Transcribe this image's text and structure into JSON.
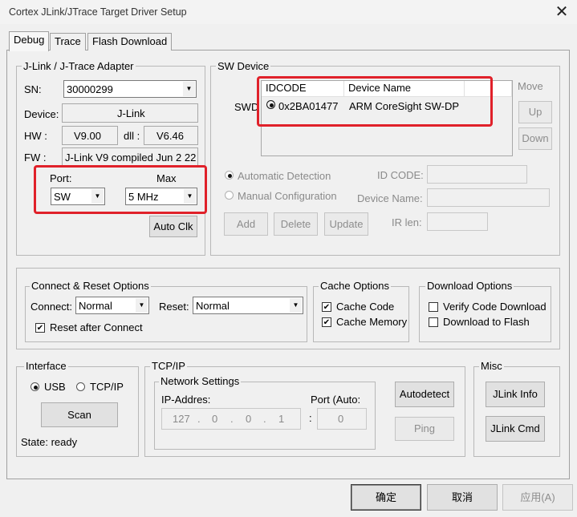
{
  "window": {
    "title": "Cortex JLink/JTrace Target Driver Setup"
  },
  "tabs": [
    "Debug",
    "Trace",
    "Flash Download"
  ],
  "adapter": {
    "group_label": "J-Link / J-Trace Adapter",
    "sn_label": "SN:",
    "sn_value": "30000299",
    "device_label": "Device:",
    "device_value": "J-Link",
    "hw_label": "HW :",
    "hw_value": "V9.00",
    "dll_label": "dll :",
    "dll_value": "V6.46",
    "fw_label": "FW :",
    "fw_value": "J-Link V9 compiled Jun  2 22",
    "port_label": "Port:",
    "port_value": "SW",
    "max_label": "Max",
    "max_value": "5 MHz",
    "auto_clk": "Auto Clk"
  },
  "sw_device": {
    "group_label": "SW Device",
    "swd_label": "SWD",
    "col_idcode": "IDCODE",
    "col_name": "Device Name",
    "row_idcode": "0x2BA01477",
    "row_name": "ARM CoreSight SW-DP",
    "move_label": "Move",
    "up": "Up",
    "down": "Down",
    "auto_detect": "Automatic Detection",
    "manual_config": "Manual Configuration",
    "id_code_label": "ID CODE:",
    "device_name_label": "Device Name:",
    "ir_len_label": "IR len:",
    "add": "Add",
    "delete": "Delete",
    "update": "Update"
  },
  "connect_reset": {
    "group_label": "Connect & Reset Options",
    "connect_label": "Connect:",
    "connect_value": "Normal",
    "reset_label": "Reset:",
    "reset_value": "Normal",
    "reset_after_connect": "Reset after Connect"
  },
  "cache": {
    "group_label": "Cache Options",
    "cache_code": "Cache Code",
    "cache_memory": "Cache Memory"
  },
  "download": {
    "group_label": "Download Options",
    "verify": "Verify Code Download",
    "to_flash": "Download to Flash"
  },
  "interface": {
    "group_label": "Interface",
    "usb": "USB",
    "tcpip": "TCP/IP",
    "scan": "Scan",
    "state": "State: ready"
  },
  "tcpip": {
    "group_label": "TCP/IP",
    "network_label": "Network Settings",
    "ip_label": "IP-Addres:",
    "port_label": "Port (Auto:",
    "ip": [
      "127",
      "0",
      "0",
      "1"
    ],
    "port_value": "0",
    "autodetect": "Autodetect",
    "ping": "Ping"
  },
  "misc": {
    "group_label": "Misc",
    "jlink_info": "JLink Info",
    "jlink_cmd": "JLink Cmd"
  },
  "footer": {
    "ok": "确定",
    "cancel": "取消",
    "apply": "应用(A)"
  },
  "colors": {
    "highlight_box": "#e0212a",
    "background": "#f0f0f0"
  }
}
